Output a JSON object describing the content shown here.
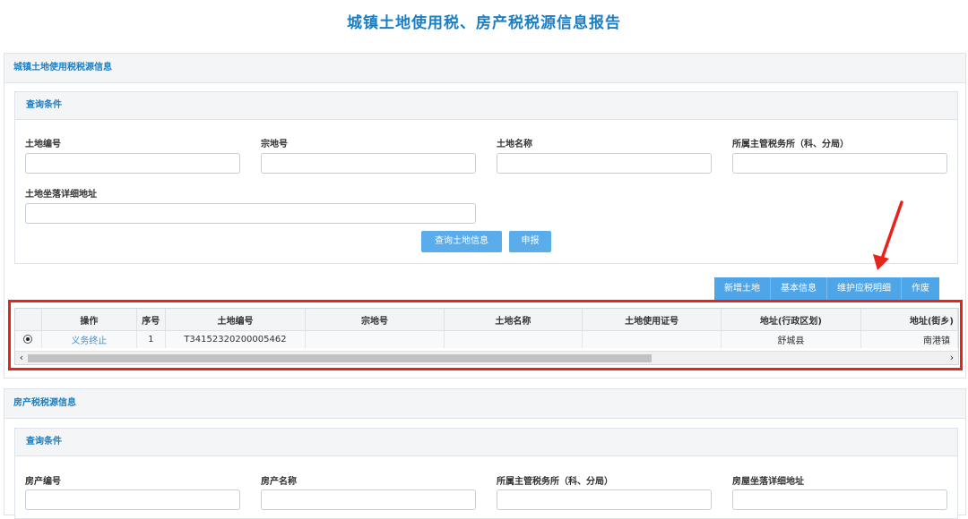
{
  "page": {
    "title": "城镇土地使用税、房产税税源信息报告"
  },
  "land_section": {
    "header": "城镇土地使用税税源信息",
    "query": {
      "header": "查询条件",
      "fields": {
        "land_no": "土地编号",
        "parcel_no": "宗地号",
        "land_name": "土地名称",
        "tax_office": "所属主管税务所（科、分局）",
        "land_address": "土地坐落详细地址"
      },
      "buttons": {
        "query": "查询土地信息",
        "declare": "申报"
      }
    },
    "toolbar": [
      "新增土地",
      "基本信息",
      "维护应税明细",
      "作废"
    ],
    "table": {
      "columns": [
        "操作",
        "序号",
        "土地编号",
        "宗地号",
        "土地名称",
        "土地使用证号",
        "地址(行政区划)",
        "地址(街乡)"
      ],
      "rows": [
        {
          "action": "义务终止",
          "index": "1",
          "land_no": "T34152320200005462",
          "parcel_no": "",
          "land_name": "",
          "cert_no": "",
          "region": "舒城县",
          "street": "南港镇"
        }
      ]
    }
  },
  "house_section": {
    "header": "房产税税源信息",
    "query": {
      "header": "查询条件",
      "fields": {
        "house_no": "房产编号",
        "house_name": "房产名称",
        "tax_office": "所属主管税务所（科、分局）",
        "house_address": "房屋坐落详细地址"
      }
    }
  },
  "icons": {
    "scroll_left": "chevron-left-icon",
    "scroll_right": "chevron-right-icon",
    "annotation": "red-arrow"
  },
  "colors": {
    "accent": "#1a7fc4",
    "button": "#5aacea",
    "highlight": "#e8231a"
  }
}
